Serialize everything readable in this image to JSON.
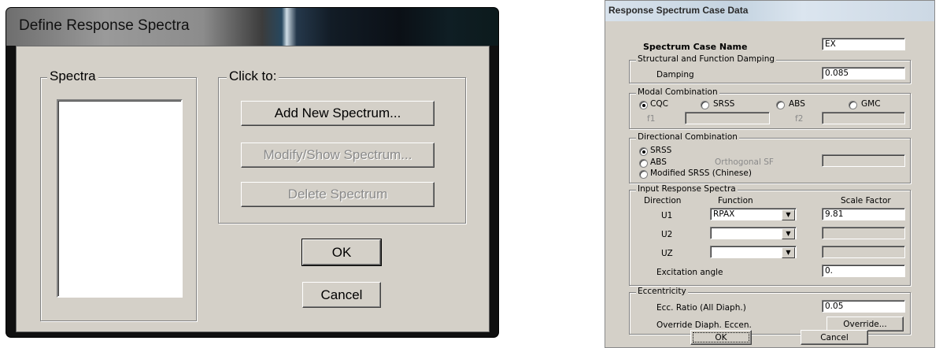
{
  "define_dialog": {
    "title": "Define Response Spectra",
    "spectra_group_label": "Spectra",
    "click_to_label": "Click to:",
    "add_button": "Add New Spectrum...",
    "modify_button": "Modify/Show Spectrum...",
    "delete_button": "Delete Spectrum",
    "ok_button": "OK",
    "cancel_button": "Cancel"
  },
  "case_dialog": {
    "title": "Response Spectrum Case Data",
    "case_name_label": "Spectrum Case Name",
    "case_name_value": "EX",
    "damping_group": "Structural and Function Damping",
    "damping_label": "Damping",
    "damping_value": "0.085",
    "modal_group": "Modal Combination",
    "modal_options": [
      "CQC",
      "SRSS",
      "ABS",
      "GMC"
    ],
    "modal_selected": "CQC",
    "f1_label": "f1",
    "f2_label": "f2",
    "directional_group": "Directional Combination",
    "dir_options": [
      "SRSS",
      "ABS",
      "Modified SRSS (Chinese)"
    ],
    "dir_selected": "SRSS",
    "orthogonal_label": "Orthogonal SF",
    "input_group": "Input Response Spectra",
    "col_direction": "Direction",
    "col_function": "Function",
    "col_scale": "Scale Factor",
    "rows": [
      {
        "dir": "U1",
        "func": "RPAX",
        "scale": "9.81"
      },
      {
        "dir": "U2",
        "func": "",
        "scale": ""
      },
      {
        "dir": "UZ",
        "func": "",
        "scale": ""
      }
    ],
    "excitation_label": "Excitation angle",
    "excitation_value": "0.",
    "ecc_group": "Eccentricity",
    "ecc_ratio_label": "Ecc. Ratio (All Diaph.)",
    "ecc_ratio_value": "0.05",
    "override_label": "Override Diaph. Eccen.",
    "override_button": "Override...",
    "ok_button": "OK",
    "cancel_button": "Cancel"
  }
}
